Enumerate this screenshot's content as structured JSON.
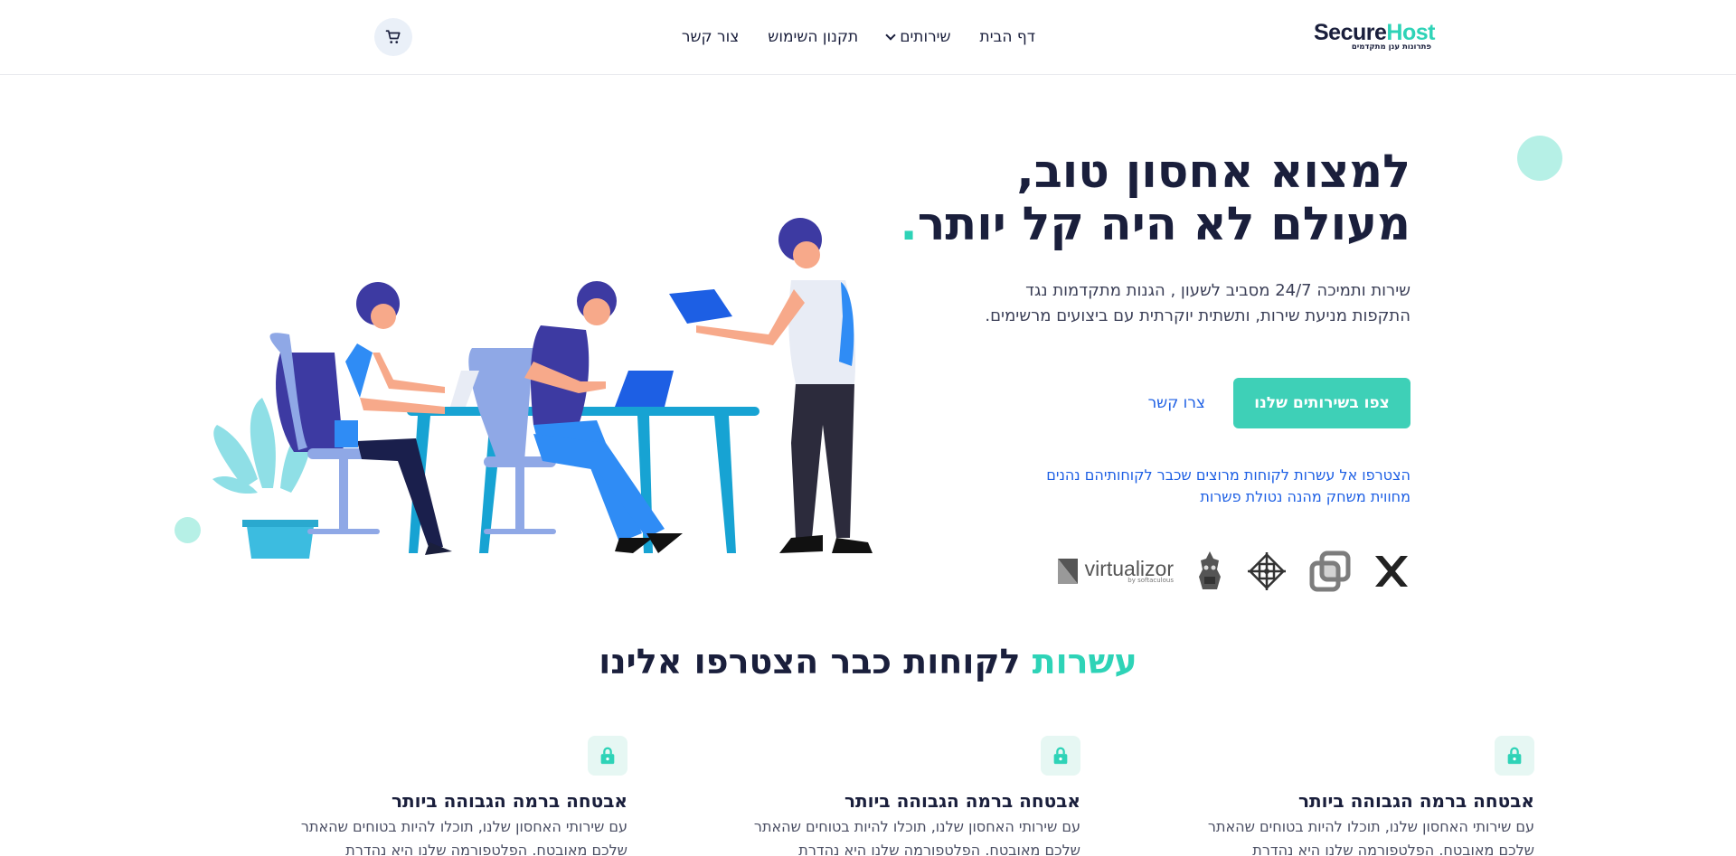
{
  "header": {
    "logo": {
      "word_dark": "Secure",
      "word_accent": "Host",
      "tagline": "פתרונות ענן מתקדמים"
    },
    "nav": [
      {
        "label": "דף הבית"
      },
      {
        "label": "שירותים",
        "has_dropdown": true
      },
      {
        "label": "תקנון השימוש"
      },
      {
        "label": "צור קשר"
      }
    ],
    "cart_icon": "cart-icon"
  },
  "hero": {
    "title_line1": "למצוא אחסון טוב,",
    "title_line2": "מעולם לא היה קל יותר",
    "title_dot": ".",
    "subtitle": "שירות ותמיכה 24/7 מסביב לשעון , הגנות מתקדמות נגד התקפות מניעת שירות, ותשתית יוקרתית עם ביצועים מרשימים.",
    "primary_button": "צפו בשירותים שלנו",
    "secondary_link": "צרו קשר",
    "join_note": "הצטרפו אל עשרות לקוחות מרוצים שכבר לקוחותיהם נהנים מחווית משחק מהנה נטולת פשרות",
    "partners": [
      {
        "icon": "x-logo-icon"
      },
      {
        "icon": "layers-logo-icon"
      },
      {
        "icon": "centos-logo-icon"
      },
      {
        "icon": "knight-logo-icon"
      },
      {
        "icon": "virtualizor-logo-icon",
        "name": "virtualizor",
        "sub": "by softaculous"
      }
    ],
    "illustration": "team-working-illustration"
  },
  "section": {
    "title_accent": "עשרות",
    "title_rest": " לקוחות כבר הצטרפו אלינו"
  },
  "features": [
    {
      "icon": "lock-icon",
      "title": "אבטחה ברמה הגבוהה ביותר",
      "text": "עם שירותי האחסון שלנו, תוכלו להיות בטוחים שהאתר שלכם מאובטח. הפלטפורמה שלנו היא נהדרת ומושלמת"
    },
    {
      "icon": "lock-icon",
      "title": "אבטחה ברמה הגבוהה ביותר",
      "text": "עם שירותי האחסון שלנו, תוכלו להיות בטוחים שהאתר שלכם מאובטח. הפלטפורמה שלנו היא נהדרת ומושלמת"
    },
    {
      "icon": "lock-icon",
      "title": "אבטחה ברמה הגבוהה ביותר",
      "text": "עם שירותי האחסון שלנו, תוכלו להיות בטוחים שהאתר שלכם מאובטח. הפלטפורמה שלנו היא נהדרת ומושלמת"
    }
  ],
  "colors": {
    "accent": "#2ed3b7",
    "navy": "#1a1f3c",
    "link": "#1d5fe4",
    "button": "#3ed0b7"
  }
}
